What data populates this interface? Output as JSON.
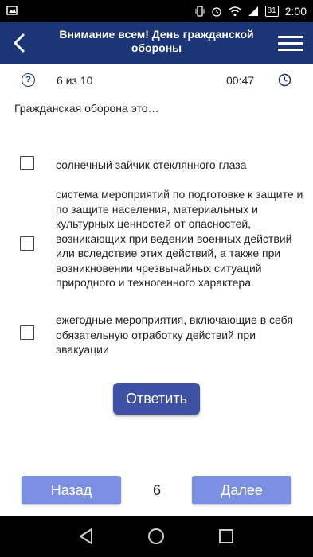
{
  "status_bar": {
    "battery": "81",
    "time": "2:00",
    "icons": [
      "image-icon",
      "vibrate-icon",
      "alarm-icon",
      "wifi-icon",
      "signal-icon",
      "battery-icon"
    ]
  },
  "app_bar": {
    "title": "Внимание всем! День гражданской обороны",
    "back_icon": "back-arrow-icon",
    "menu_icon": "hamburger-menu-icon"
  },
  "info_bar": {
    "help_glyph": "?",
    "counter": "6 из 10",
    "timer": "00:47"
  },
  "question": "Гражданская оборона это…",
  "options": [
    {
      "text": "солнечный зайчик стеклянного глаза",
      "checked": false
    },
    {
      "text": "система мероприятий по подготовке к защите и по защите населения, материальных и культурных ценностей от опасностей, возникающих при ведении военных действий или вследствие этих действий, а также при возникновении чрезвычайных ситуаций природного и техногенного характера.",
      "checked": false
    },
    {
      "text": "ежегодные мероприятия, включающие в себя обязательную отработку действий при эвакуации",
      "checked": false
    }
  ],
  "answer_button": "Ответить",
  "pagination": {
    "prev": "Назад",
    "page": "6",
    "next": "Далее"
  },
  "colors": {
    "app_bar": "#1b3577",
    "answer_button": "#3f51a5",
    "nav_button": "#7b90e3"
  }
}
